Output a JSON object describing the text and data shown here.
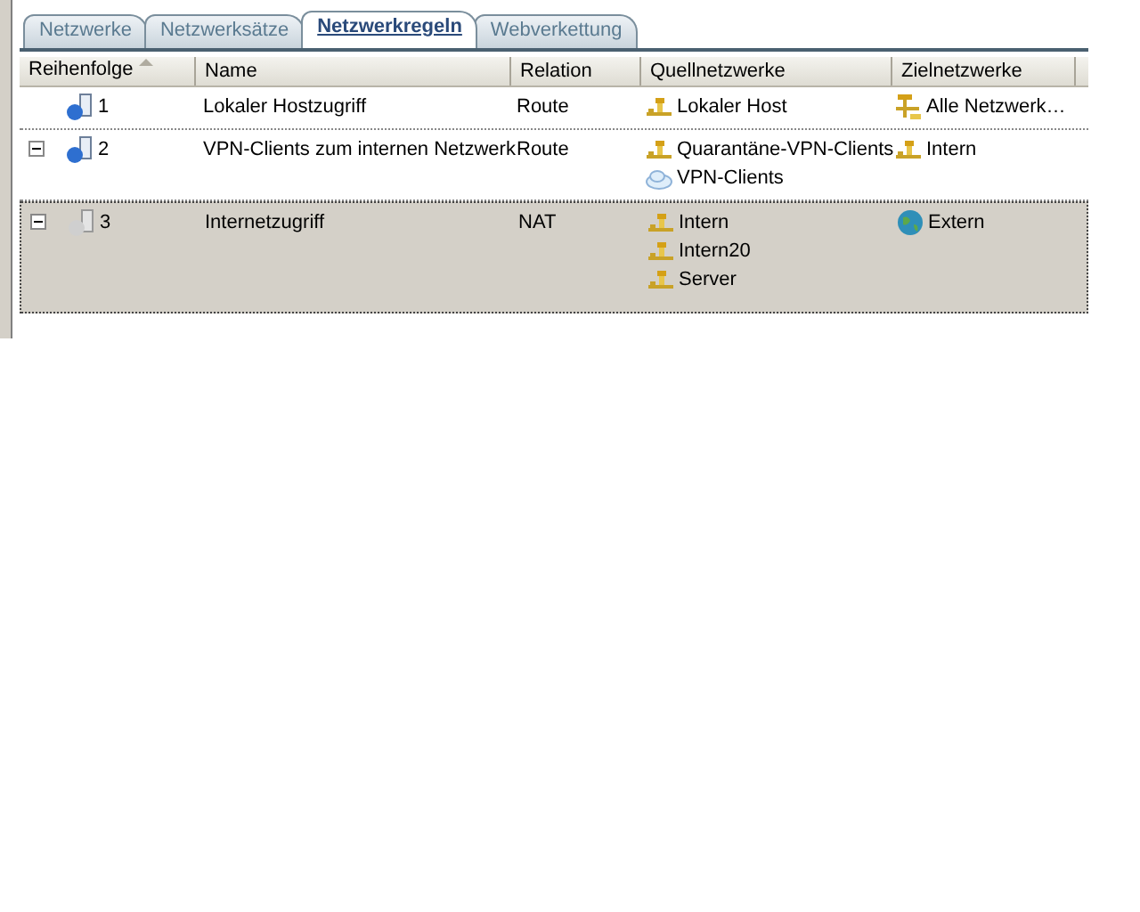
{
  "tabs": [
    {
      "label": "Netzwerke",
      "selected": false
    },
    {
      "label": "Netzwerksätze",
      "selected": false
    },
    {
      "label": "Netzwerkregeln",
      "selected": true
    },
    {
      "label": "Webverkettung",
      "selected": false
    }
  ],
  "table": {
    "columns": [
      {
        "label": "Reihenfolge",
        "sorted": true
      },
      {
        "label": "Name",
        "sorted": false
      },
      {
        "label": "Relation",
        "sorted": false
      },
      {
        "label": "Quellnetzwerke",
        "sorted": false
      },
      {
        "label": "Zielnetzwerke",
        "sorted": false
      }
    ],
    "rows": [
      {
        "order": "1",
        "name": "Lokaler Hostzugriff",
        "relation": "Route",
        "expanded": false,
        "disabled": false,
        "selected": false,
        "sources": [
          {
            "kind": "network",
            "label": "Lokaler Host"
          }
        ],
        "destinations": [
          {
            "kind": "all",
            "label": "Alle Netzwerk…"
          }
        ]
      },
      {
        "order": "2",
        "name": "VPN-Clients zum internen Netzwerk",
        "relation": "Route",
        "expanded": true,
        "disabled": false,
        "selected": false,
        "sources": [
          {
            "kind": "network",
            "label": "Quarantäne-VPN-Clients"
          },
          {
            "kind": "cloud",
            "label": "VPN-Clients"
          }
        ],
        "destinations": [
          {
            "kind": "network",
            "label": "Intern"
          }
        ]
      },
      {
        "order": "3",
        "name": "Internetzugriff",
        "relation": "NAT",
        "expanded": true,
        "disabled": true,
        "selected": true,
        "sources": [
          {
            "kind": "network",
            "label": "Intern"
          },
          {
            "kind": "network",
            "label": "Intern20"
          },
          {
            "kind": "network",
            "label": "Server"
          }
        ],
        "destinations": [
          {
            "kind": "globe",
            "label": "Extern"
          }
        ]
      }
    ]
  }
}
